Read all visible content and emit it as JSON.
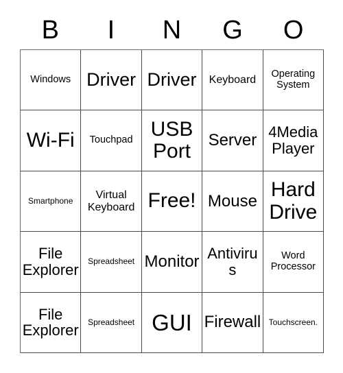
{
  "card": {
    "header": {
      "letters": [
        "B",
        "I",
        "N",
        "G",
        "O"
      ]
    },
    "rows": [
      [
        {
          "text": "Windows",
          "size": "fs-sm"
        },
        {
          "text": "Driver",
          "size": "fs-2xl"
        },
        {
          "text": "Driver",
          "size": "fs-2xl"
        },
        {
          "text": "Keyboard",
          "size": "fs-md"
        },
        {
          "text": "Operating System",
          "size": "fs-sm"
        }
      ],
      [
        {
          "text": "Wi-Fi",
          "size": "fs-3xl"
        },
        {
          "text": "Touchpad",
          "size": "fs-sm"
        },
        {
          "text": "USB Port",
          "size": "fs-3xl"
        },
        {
          "text": "Server",
          "size": "fs-xl"
        },
        {
          "text": "4Media Player",
          "size": "fs-lg"
        }
      ],
      [
        {
          "text": "Smartphone",
          "size": "fs-xs"
        },
        {
          "text": "Virtual Keyboard",
          "size": "fs-md"
        },
        {
          "text": "Free!",
          "size": "fs-3xl"
        },
        {
          "text": "Mouse",
          "size": "fs-xl"
        },
        {
          "text": "Hard Drive",
          "size": "fs-3xl"
        }
      ],
      [
        {
          "text": "File Explorer",
          "size": "fs-lg"
        },
        {
          "text": "Spreadsheet",
          "size": "fs-xs"
        },
        {
          "text": "Monitor",
          "size": "fs-xl"
        },
        {
          "text": "Antivirus",
          "size": "fs-lg"
        },
        {
          "text": "Word Processor",
          "size": "fs-sm"
        }
      ],
      [
        {
          "text": "File Explorer",
          "size": "fs-lg"
        },
        {
          "text": "Spreadsheet",
          "size": "fs-xs"
        },
        {
          "text": "GUI",
          "size": "fs-4xl"
        },
        {
          "text": "Firewall",
          "size": "fs-xl"
        },
        {
          "text": "Touchscreen.",
          "size": "fs-xs"
        }
      ]
    ]
  },
  "colors": {
    "background": "#ffffff",
    "text": "#000000",
    "grid_line": "#4a4a4a",
    "outer_line": "#6b6b6b"
  }
}
